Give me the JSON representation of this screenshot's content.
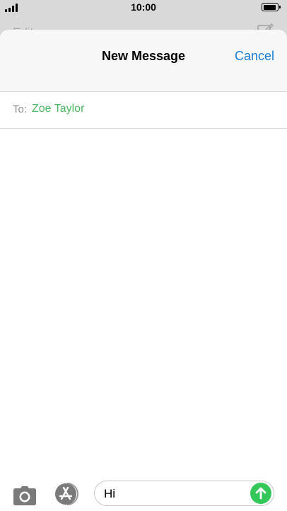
{
  "status_bar": {
    "time": "10:00",
    "battery_level": 0.9
  },
  "background_screen": {
    "edit_label": "Edit",
    "compose_icon": "compose-icon"
  },
  "new_message": {
    "title": "New Message",
    "cancel_label": "Cancel",
    "to_label": "To:",
    "recipient": "Zoe Taylor"
  },
  "input_bar": {
    "camera_icon": "camera-icon",
    "appstore_icon": "app-store-icon",
    "message_text": "Hi",
    "send_icon": "send-arrow-icon"
  },
  "colors": {
    "accent_blue": "#1a7ed6",
    "recipient_green": "#4cb963",
    "send_green": "#34c759",
    "icon_gray": "#7a7a7a"
  }
}
